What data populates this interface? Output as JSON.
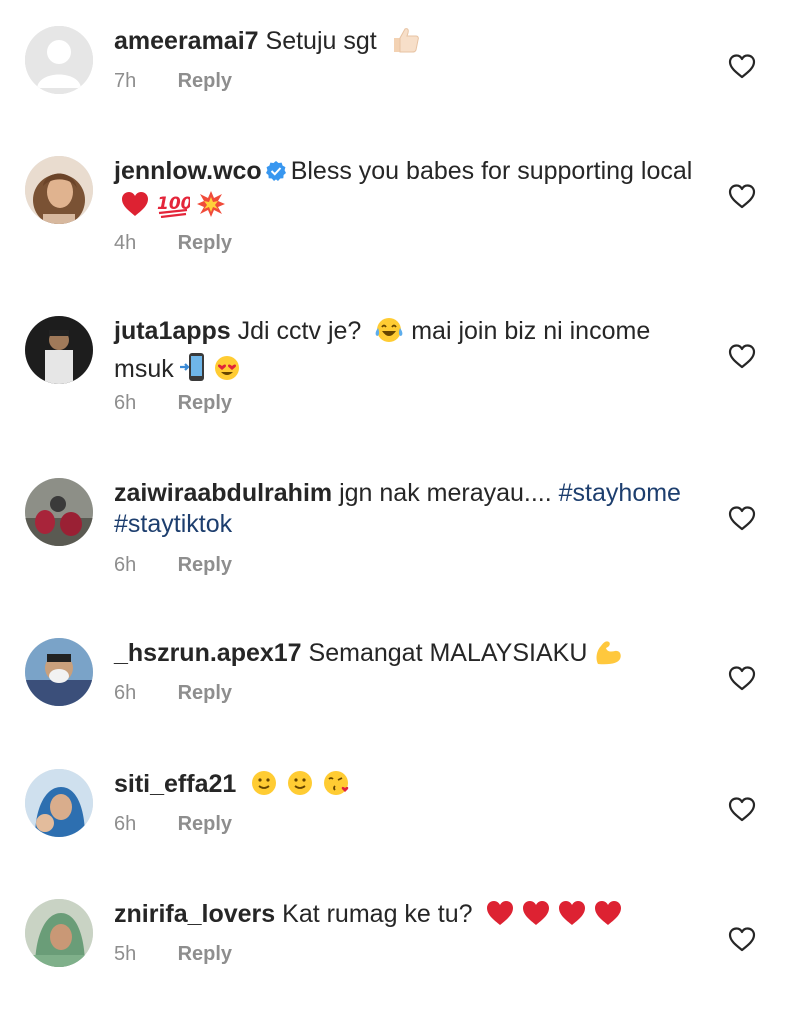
{
  "comments": [
    {
      "username": "ameeramai7",
      "verified": false,
      "text": "Setuju sgt",
      "hashtags": "",
      "time": "7h",
      "reply_label": "Reply",
      "emoji": [
        "thumbs-up"
      ]
    },
    {
      "username": "jennlow.wco",
      "verified": true,
      "text": "Bless you babes for supporting local",
      "hashtags": "",
      "time": "4h",
      "reply_label": "Reply",
      "emoji": [
        "red-heart",
        "hundred-points",
        "collision"
      ]
    },
    {
      "username": "juta1apps",
      "verified": false,
      "text": "Jdi cctv je?",
      "text2": "mai join biz ni income msuk",
      "hashtags": "",
      "time": "6h",
      "reply_label": "Reply",
      "emoji": [
        "tears-of-joy",
        "mobile-arrow",
        "heart-eyes"
      ]
    },
    {
      "username": "zaiwiraabdulrahim",
      "verified": false,
      "text": "jgn nak merayau....",
      "hashtags": "#stayhome #staytiktok",
      "time": "6h",
      "reply_label": "Reply",
      "emoji": []
    },
    {
      "username": "_hszrun.apex17",
      "verified": false,
      "text": "Semangat MALAYSIAKU",
      "hashtags": "",
      "time": "6h",
      "reply_label": "Reply",
      "emoji": [
        "flexed-biceps"
      ]
    },
    {
      "username": "siti_effa21",
      "verified": false,
      "text": "",
      "hashtags": "",
      "time": "6h",
      "reply_label": "Reply",
      "emoji": [
        "slight-smile",
        "slight-smile",
        "face-blowing-kiss"
      ]
    },
    {
      "username": "znirifa_lovers",
      "verified": false,
      "text": "Kat rumag ke tu?",
      "hashtags": "",
      "time": "5h",
      "reply_label": "Reply",
      "emoji": [
        "red-heart",
        "red-heart",
        "red-heart",
        "red-heart"
      ]
    }
  ],
  "icons": {
    "like": "heart-outline-icon",
    "verified": "verified-badge-icon"
  },
  "colors": {
    "text": "#262626",
    "muted": "#8e8e8e",
    "hashtag": "#1d3e6e",
    "verified": "#3897f0",
    "heart": "#262626"
  }
}
